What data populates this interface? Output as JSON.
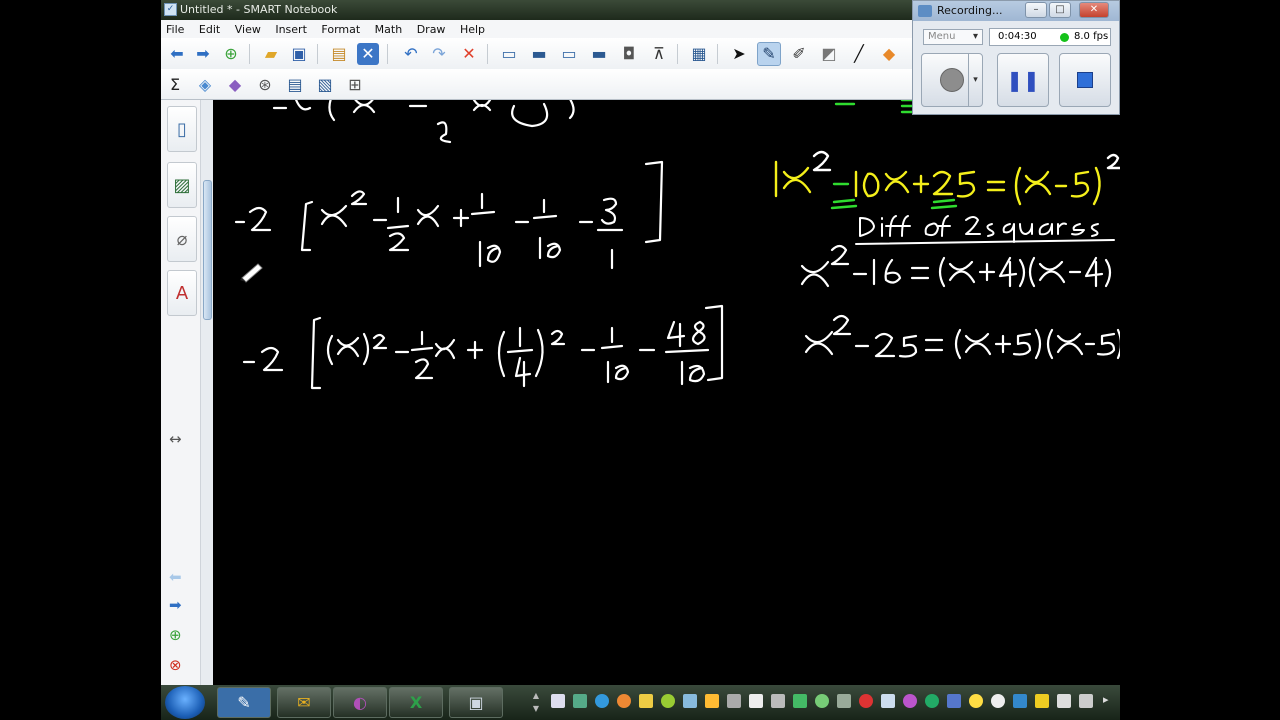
{
  "window": {
    "title": "Untitled * - SMART Notebook"
  },
  "menubar": {
    "items": [
      "File",
      "Edit",
      "View",
      "Insert",
      "Format",
      "Math",
      "Draw",
      "Help"
    ]
  },
  "recorder": {
    "title": "Recording...",
    "menu_label": "Menu",
    "elapsed": "0:04:30",
    "fps": "8.0 fps",
    "status_color": "#15c21a"
  },
  "colors": {
    "ink_white": "#ffffff",
    "ink_yellow": "#f4ef1a",
    "ink_green": "#2fdc2f"
  },
  "canvas": {
    "notes": [
      "-2 [x² - ½x + 1/16 - 1/16 - 3/1]",
      "-2 [(x)² - ½x + (¼)² - 1/16 - 48/16]",
      "x² - 10x + 25 = (x - 5)²",
      "Diff of 2squares",
      "x² - 16 = (x+4)(x-4)",
      "x² - 25 = (x+5)(x-5)"
    ]
  }
}
